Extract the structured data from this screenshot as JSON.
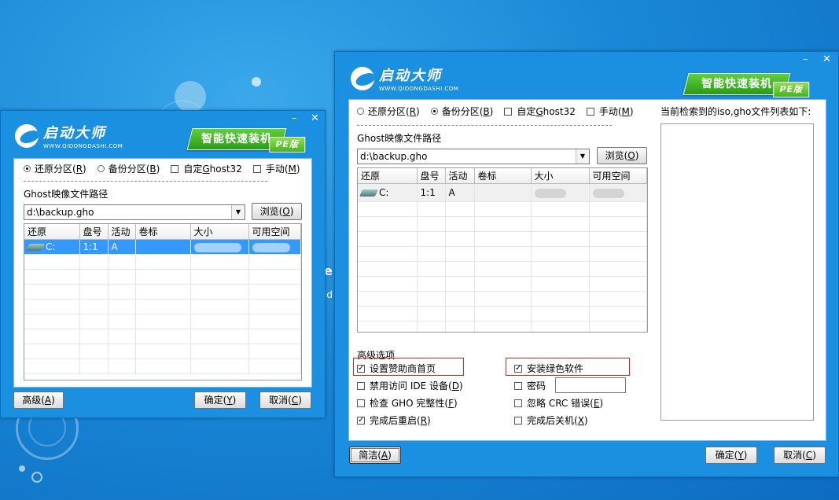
{
  "brand": {
    "name": "启动大师",
    "site": "WWW.QIDONGDASHI.COM",
    "badge": "智能快速装机",
    "badge_pe": "PE版"
  },
  "window_controls": {
    "minimize": "–",
    "close": "✕"
  },
  "left_window": {
    "modes": [
      {
        "label": "还原分区(",
        "key": "R",
        "end": ")",
        "selected": true
      },
      {
        "label": "备份分区(",
        "key": "B",
        "end": ")",
        "selected": false
      }
    ],
    "custom_ghost": {
      "pre": "自定",
      "key": "G",
      "post": "host32",
      "checked": false
    },
    "manual": {
      "label": "手动(",
      "key": "M",
      "end": ")",
      "checked": false
    },
    "path_label": "Ghost映像文件路径",
    "path_value": "d:\\backup.gho",
    "browse": {
      "label": "浏览(",
      "key": "O",
      "end": ")"
    },
    "columns": [
      "还原",
      "盘号",
      "活动",
      "卷标",
      "大小",
      "可用空间"
    ],
    "rows": [
      {
        "drive": "C:",
        "disk": "1:1",
        "active": "A",
        "label": "",
        "size": "",
        "free": ""
      }
    ],
    "advanced": {
      "label": "高级(",
      "key": "A",
      "end": ")"
    },
    "ok": {
      "label": "确定(",
      "key": "Y",
      "end": ")"
    },
    "cancel": {
      "label": "取消(",
      "key": "C",
      "end": ")"
    }
  },
  "right_window": {
    "modes": [
      {
        "label": "还原分区(",
        "key": "R",
        "end": ")",
        "selected": false
      },
      {
        "label": "备份分区(",
        "key": "B",
        "end": ")",
        "selected": true
      }
    ],
    "custom_ghost": {
      "pre": "自定",
      "key": "G",
      "post": "host32",
      "checked": false
    },
    "manual": {
      "label": "手动(",
      "key": "M",
      "end": ")",
      "checked": false
    },
    "path_label": "Ghost映像文件路径",
    "path_value": "d:\\backup.gho",
    "browse": {
      "label": "浏览(",
      "key": "O",
      "end": ")"
    },
    "columns": [
      "还原",
      "盘号",
      "活动",
      "卷标",
      "大小",
      "可用空间"
    ],
    "rows": [
      {
        "drive": "C:",
        "disk": "1:1",
        "active": "A",
        "label": "",
        "size": "",
        "free": ""
      }
    ],
    "list_title": "当前检索到的iso,gho文件列表如下:",
    "advanced_title": "高级选项",
    "options_left": [
      {
        "label": "设置赞助商首页",
        "key": "",
        "end": "",
        "checked": true
      },
      {
        "label": "禁用访问 IDE 设备(",
        "key": "D",
        "end": ")",
        "checked": false
      },
      {
        "label": "检查 GHO 完整性(",
        "key": "F",
        "end": ")",
        "checked": false
      },
      {
        "label": "完成后重启(",
        "key": "R",
        "end": ")",
        "checked": true
      }
    ],
    "options_right": [
      {
        "label": "安装绿色软件",
        "key": "",
        "end": "",
        "checked": true
      },
      {
        "label": "密码",
        "key": "",
        "end": "",
        "checked": false
      },
      {
        "label": "忽略 CRC 错误(",
        "key": "E",
        "end": ")",
        "checked": false
      },
      {
        "label": "完成后关机(",
        "key": "X",
        "end": ")",
        "checked": false
      }
    ],
    "password_value": "",
    "simple": {
      "label": "简洁(",
      "key": "A",
      "end": ")"
    },
    "ok": {
      "label": "确定(",
      "key": "Y",
      "end": ")"
    },
    "cancel": {
      "label": "取消(",
      "key": "C",
      "end": ")"
    }
  },
  "background_fragments": {
    "a": "e",
    "b": "id"
  },
  "colors": {
    "desktop": "#1a88d6",
    "window": "#1b8fe0",
    "selection": "#3399ff",
    "badge_green": "#2c9a1a",
    "highlight_red": "#dd2222"
  }
}
